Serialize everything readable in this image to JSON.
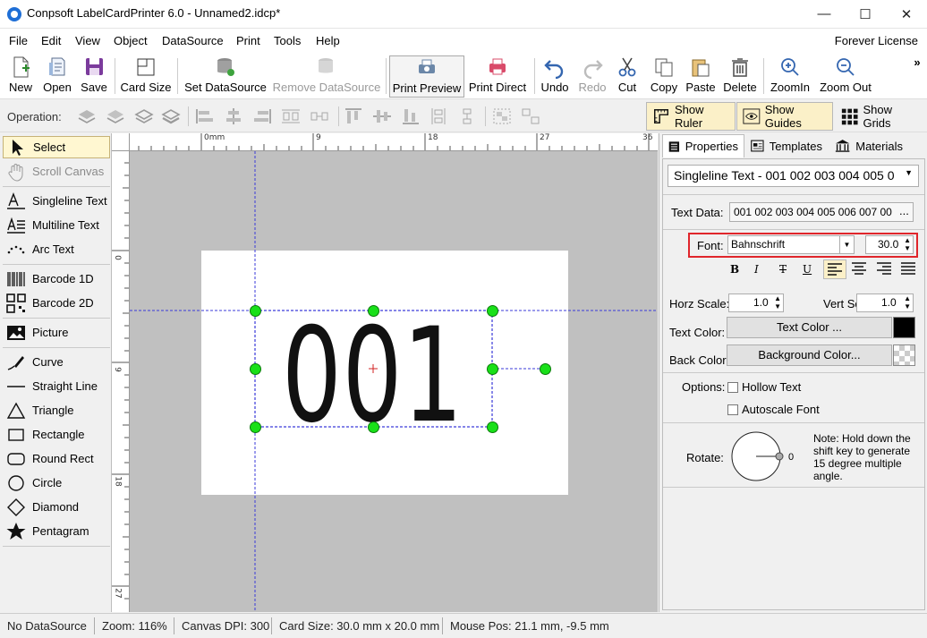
{
  "window": {
    "title": "Conpsoft LabelCardPrinter 6.0 - Unnamed2.idcp*",
    "minimize": "—",
    "maximize": "☐",
    "close": "✕"
  },
  "menu": {
    "items": [
      "File",
      "Edit",
      "View",
      "Object",
      "DataSource",
      "Print",
      "Tools",
      "Help"
    ],
    "license": "Forever License"
  },
  "toolbar": {
    "new": "New",
    "open": "Open",
    "save": "Save",
    "card_size": "Card Size",
    "set_datasource": "Set DataSource",
    "remove_datasource": "Remove DataSource",
    "print_preview": "Print Preview",
    "print_direct": "Print Direct",
    "undo": "Undo",
    "redo": "Redo",
    "cut": "Cut",
    "copy": "Copy",
    "paste": "Paste",
    "delete": "Delete",
    "zoom_in": "ZoomIn",
    "zoom_out": "Zoom Out",
    "more": "»"
  },
  "operation": {
    "label": "Operation:",
    "show_ruler": "Show Ruler",
    "show_guides": "Show Guides",
    "show_grids": "Show Grids"
  },
  "tools": {
    "select": "Select",
    "scroll_canvas": "Scroll Canvas",
    "singleline_text": "Singleline Text",
    "multiline_text": "Multiline Text",
    "arc_text": "Arc Text",
    "barcode_1d": "Barcode 1D",
    "barcode_2d": "Barcode 2D",
    "picture": "Picture",
    "curve": "Curve",
    "straight_line": "Straight Line",
    "triangle": "Triangle",
    "rectangle": "Rectangle",
    "round_rect": "Round Rect",
    "circle": "Circle",
    "diamond": "Diamond",
    "pentagram": "Pentagram"
  },
  "ruler": {
    "unit": "0mm",
    "top_ticks": [
      "9",
      "18",
      "27",
      "36"
    ],
    "left_ticks": [
      "0",
      "9",
      "18",
      "27"
    ]
  },
  "canvas": {
    "text": "001"
  },
  "panel": {
    "tabs": {
      "properties": "Properties",
      "templates": "Templates",
      "materials": "Materials"
    },
    "object_select": "Singleline Text - 001 002 003 004 005 0",
    "text_data_label": "Text Data:",
    "text_data_value": "001 002 003 004 005 006 007 00",
    "ellipsis": "...",
    "font_label": "Font:",
    "font_value": "Bahnschrift",
    "font_size": "30.0",
    "bold": "B",
    "italic": "I",
    "strike": "T",
    "underline": "U",
    "horz_scale_label": "Horz Scale:",
    "horz_scale": "1.0",
    "vert_scale_label": "Vert Scale:",
    "vert_scale": "1.0",
    "text_color_label": "Text Color:",
    "text_color_btn": "Text Color ...",
    "back_color_label": "Back Color:",
    "back_color_btn": "Background Color...",
    "options_label": "Options:",
    "hollow_text": "Hollow Text",
    "autoscale_font": "Autoscale Font",
    "rotate_label": "Rotate:",
    "rotate_value": "0",
    "note": "Note: Hold down the shift key to generate 15 degree multiple angle.",
    "text_color": "#000000",
    "highlight_color": "#e0252b"
  },
  "status": {
    "datasource": "No DataSource",
    "zoom": "Zoom: 116%",
    "dpi": "Canvas DPI: 300",
    "card_size": "Card Size: 30.0 mm x 20.0 mm",
    "mouse_pos": "Mouse Pos: 21.1 mm, -9.5 mm"
  }
}
